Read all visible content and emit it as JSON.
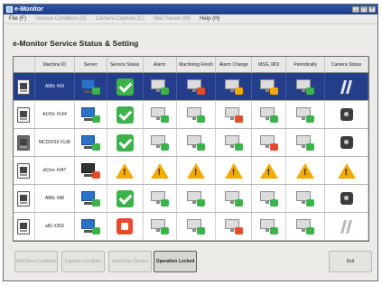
{
  "window": {
    "title": "e-Monitor"
  },
  "menu": [
    {
      "label": "File (F)",
      "disabled": false
    },
    {
      "label": "Service Condition (S)",
      "disabled": true
    },
    {
      "label": "Camera Capture (C)",
      "disabled": true
    },
    {
      "label": "Mail Server (M)",
      "disabled": true
    },
    {
      "label": "Help (H)",
      "disabled": false
    }
  ],
  "heading": "e-Monitor Service Status & Setting",
  "table": {
    "columns": [
      "",
      "Machine ID",
      "Server",
      "Service Status",
      "Alarm",
      "Machining Finish",
      "Alarm Change",
      "MSG, MDI",
      "Periodically",
      "Camera Status"
    ],
    "rows": [
      {
        "machine_id": "A88c #69",
        "selected": true,
        "server": "server-ok",
        "service": "check",
        "cols": [
          "mon-ok",
          "mon-err",
          "mon-warn",
          "mon-warn",
          "mon-ok"
        ],
        "camera": "pause"
      },
      {
        "machine_id": "A100c #144",
        "selected": false,
        "server": "server-ok",
        "service": "check",
        "cols": [
          "mon-ok",
          "mon-ok",
          "mon-err",
          "mon-ok",
          "mon-ok"
        ],
        "camera": "camera"
      },
      {
        "machine_id": "MCD2016 #138",
        "selected": false,
        "server": "server-ok",
        "service": "check",
        "cols": [
          "mon-ok",
          "mon-ok",
          "mon-ok",
          "mon-err",
          "mon-ok"
        ],
        "camera": "camera"
      },
      {
        "machine_id": "a51nx #347",
        "selected": false,
        "server": "server-err",
        "service": "warn",
        "cols": [
          "warn",
          "warn",
          "warn",
          "warn",
          "warn"
        ],
        "camera": "warn"
      },
      {
        "machine_id": "A88c #88",
        "selected": false,
        "server": "server-ok",
        "service": "check",
        "cols": [
          "mon-ok",
          "mon-ok",
          "mon-ok",
          "mon-ok",
          "mon-ok"
        ],
        "camera": "camera"
      },
      {
        "machine_id": "a81 #259",
        "selected": false,
        "server": "server-ok",
        "service": "stop",
        "cols": [
          "mon-ok",
          "mon-ok",
          "mon-err",
          "mon-ok",
          "mon-ok"
        ],
        "camera": "pause-grey"
      }
    ]
  },
  "buttons": {
    "mail_send": "Mail Send Condition",
    "capture": "Capture Condition",
    "start_stop": "Start/Stop Service",
    "operation": "Operation Locked",
    "exit": "Exit"
  }
}
